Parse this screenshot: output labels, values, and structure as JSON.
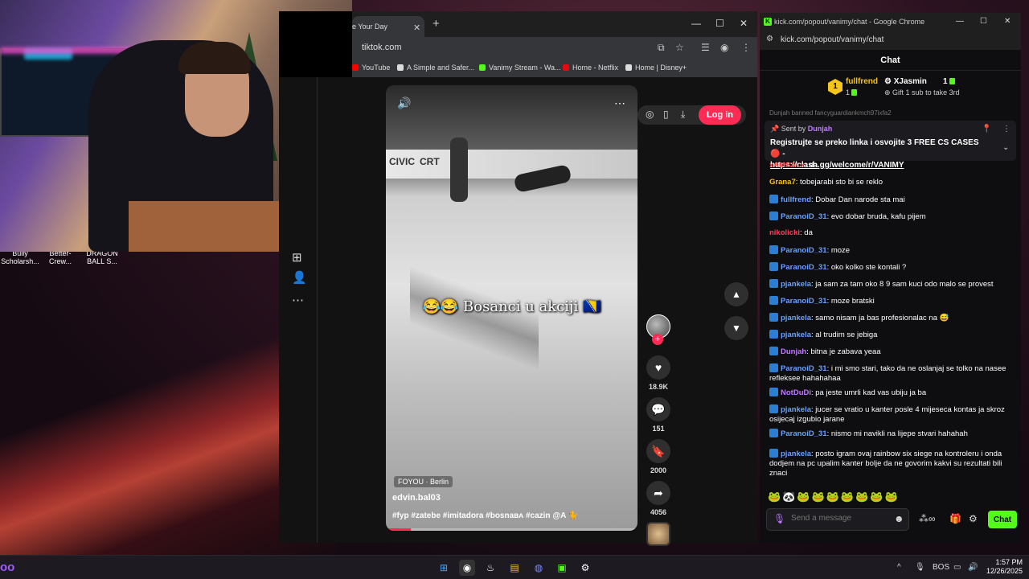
{
  "desktop": {
    "icons": [
      "Bully Scholarsh...",
      "Better-Crew...",
      "DRAGON BALL S..."
    ]
  },
  "tiktok_browser": {
    "tab_title": "e Your Day",
    "new_tab": "+",
    "url": "tiktok.com",
    "bookmarks": [
      "YouTube",
      "A Simple and Safer...",
      "Vanimy Stream - Wa...",
      "Home - Netflix",
      "Home | Disney+"
    ],
    "login_label": "Log in",
    "video": {
      "caption": "😂😂 Bosanci u akciji 🇧🇦",
      "boards": [
        "CIVIC",
        "CRT"
      ],
      "location": "FOYOU · Berlin",
      "username": "edvin.bal03",
      "hashtags": "#fyp #zatebe #imitadora #bosnaʙᴀ #cazin @A 🐈",
      "progress": 0.1
    },
    "rail": {
      "likes": "18.9K",
      "comments": "151",
      "saves": "2000",
      "shares": "4056"
    }
  },
  "kick_chat": {
    "window_title": "kick.com/popout/vanimy/chat - Google Chrome",
    "url": "kick.com/popout/vanimy/chat",
    "header": "Chat",
    "leaderboard": {
      "rank": "1",
      "first_name": "fullfrend",
      "first_count": "1",
      "second_name": "XJasmin",
      "second_count": "1",
      "gift_text": "Gift 1 sub to take 3rd"
    },
    "banned_notice": "Dunjah banned fancyguardiankmch97ixfa2",
    "pinned": {
      "sent_by": "Sent by",
      "sender": "Dunjah",
      "message": "Registrujte se preko linka i osvojite 3 FREE CS CASES 🔴 -",
      "link": "https://clash.gg/welcome/r/VANIMY"
    },
    "messages": [
      {
        "user": "xAMSALx",
        "color": "#ff4a4a",
        "text": ": da",
        "badge": false
      },
      {
        "user": "Grana7",
        "color": "#f5c518",
        "text": ": tobejarabi sto bi se reklo",
        "badge": false
      },
      {
        "user": "fullfrend",
        "color": "#6aa0ff",
        "text": ": Dobar Dan narode sta mai",
        "badge": true
      },
      {
        "user": "ParanoiD_31",
        "color": "#6aa0ff",
        "text": ": evo dobar bruda, kafu pijem",
        "badge": true
      },
      {
        "user": "nikolicki",
        "color": "#ff3a5a",
        "text": ": da",
        "badge": false
      },
      {
        "user": "ParanoiD_31",
        "color": "#6aa0ff",
        "text": ": moze",
        "badge": true
      },
      {
        "user": "ParanoiD_31",
        "color": "#6aa0ff",
        "text": ": oko kolko ste kontali ?",
        "badge": true
      },
      {
        "user": "pjankela",
        "color": "#6aa0ff",
        "text": ": ja sam za tam oko 8 9 sam kuci odo malo se provest",
        "badge": true
      },
      {
        "user": "ParanoiD_31",
        "color": "#6aa0ff",
        "text": ": moze bratski",
        "badge": true
      },
      {
        "user": "pjankela",
        "color": "#6aa0ff",
        "text": ": samo nisam ja bas profesionalac na 😅",
        "badge": true
      },
      {
        "user": "pjankela",
        "color": "#6aa0ff",
        "text": ": al trudim se jebiga",
        "badge": true
      },
      {
        "user": "Dunjah",
        "color": "#c07aff",
        "text": ": bitna je zabava yeaa",
        "badge": true
      },
      {
        "user": "ParanoiD_31",
        "color": "#6aa0ff",
        "text": ": i mi smo stari, tako da ne oslanjaj se tolko na nasee refleksee hahahahaa",
        "badge": true
      },
      {
        "user": "NotDuDi",
        "color": "#c07aff",
        "text": ": pa jeste umrli kad vas ubiju ja ba",
        "badge": true
      },
      {
        "user": "pjankela",
        "color": "#6aa0ff",
        "text": ": jucer se vratio u kanter posle 4 mijeseca kontas ja skroz osijecaj izgubio jarane",
        "badge": true
      },
      {
        "user": "ParanoiD_31",
        "color": "#6aa0ff",
        "text": ": nismo mi navikli na lijepe stvari hahahah",
        "badge": true
      },
      {
        "user": "pjankela",
        "color": "#6aa0ff",
        "text": ": posto igram ovaj rainbow six siege na kontroleru i onda dodjem na pc upalim kanter bolje da ne govorim kakvi su rezultati bili znaci",
        "badge": true
      }
    ],
    "emotes": "🐸🐼🐸🐸🐸🐸🐸🐸🐸",
    "input_placeholder": "Send a message",
    "chat_button": "Chat"
  },
  "taskbar": {
    "lang": "BOS",
    "time": "1:57 PM",
    "date": "12/26/2025"
  }
}
